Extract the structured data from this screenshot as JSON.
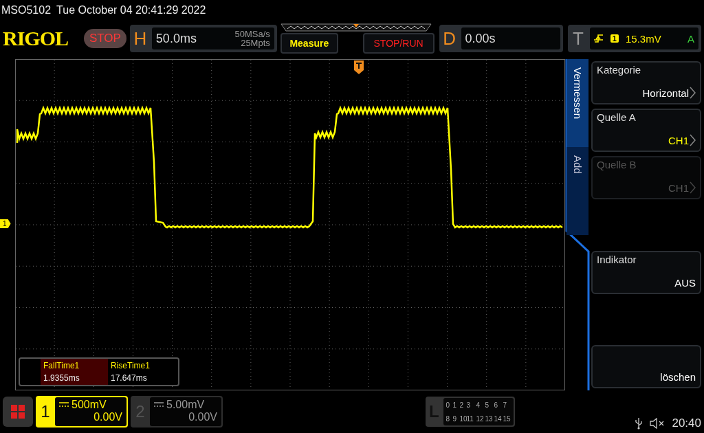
{
  "model": "MSO5102",
  "datetime": "Tue October 04 20:41:29 2022",
  "logo": "RIGOL",
  "run_state": "STOP",
  "horizontal": {
    "label": "H",
    "timebase": "50.0ms",
    "sample_rate": "50MSa/s",
    "memory_depth": "25Mpts"
  },
  "buttons": [
    {
      "label": "Measure",
      "kind": "measure"
    },
    {
      "label": "STOP/RUN",
      "kind": "run"
    }
  ],
  "delay": {
    "label": "D",
    "value": "0.00s"
  },
  "trigger": {
    "label": "T",
    "source": "1",
    "level": "15.3mV",
    "mode": "A"
  },
  "ground_marker": "1",
  "measurements": [
    {
      "name": "FallTime1",
      "value": "1.9355ms",
      "selected": true
    },
    {
      "name": "RiseTime1",
      "value": "17.647ms",
      "selected": false
    }
  ],
  "side_tabs": [
    {
      "label": "Vermessen",
      "selected": true
    },
    {
      "label": "Add",
      "selected": false
    }
  ],
  "menu": [
    {
      "kind": "option",
      "label": "Kategorie",
      "value": "Horizontal",
      "color": "#ffffff",
      "disabled": false
    },
    {
      "kind": "option",
      "label": "Quelle A",
      "value": "CH1",
      "color": "#ffff00",
      "disabled": false
    },
    {
      "kind": "option",
      "label": "Quelle B",
      "value": "CH1",
      "color": "#555555",
      "disabled": true
    },
    {
      "kind": "blank"
    },
    {
      "kind": "value",
      "label": "Indikator",
      "value": "AUS",
      "color": "#ffffff",
      "disabled": false
    },
    {
      "kind": "blank"
    },
    {
      "kind": "action",
      "value": "löschen",
      "color": "#ffffff",
      "disabled": false
    }
  ],
  "channels": [
    {
      "number": "1",
      "scale": "500mV",
      "offset": "0.00V",
      "selected": true
    },
    {
      "number": "2",
      "scale": "5.00mV",
      "offset": "0.00V",
      "selected": false
    }
  ],
  "logic": {
    "label": "L",
    "rows": [
      [
        "0",
        "1",
        "2",
        "3",
        "4",
        "5",
        "6",
        "7"
      ],
      [
        "8",
        "9",
        "10",
        "11",
        "12",
        "13",
        "14",
        "15"
      ]
    ]
  },
  "status": {
    "time": "20:40"
  }
}
